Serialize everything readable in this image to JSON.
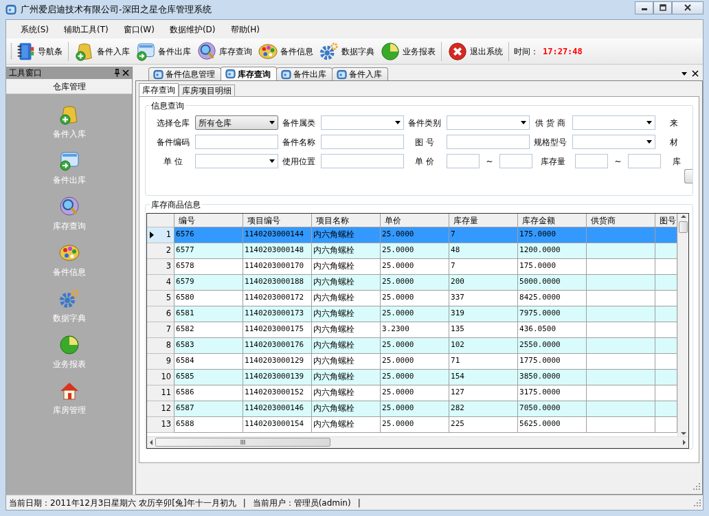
{
  "window": {
    "title": "广州爱启迪技术有限公司-深田之星仓库管理系统"
  },
  "menu": [
    {
      "label": "系统(S)"
    },
    {
      "label": "辅助工具(T)"
    },
    {
      "label": "窗口(W)"
    },
    {
      "label": "数据维护(D)"
    },
    {
      "label": "帮助(H)"
    }
  ],
  "toolbar": {
    "buttons": [
      {
        "label": "导航条"
      },
      {
        "label": "备件入库"
      },
      {
        "label": "备件出库"
      },
      {
        "label": "库存查询"
      },
      {
        "label": "备件信息"
      },
      {
        "label": "数据字典"
      },
      {
        "label": "业务报表"
      }
    ],
    "exit_button": {
      "label": "退出系统"
    },
    "clock_label": "时间：",
    "clock": "17:27:48"
  },
  "tool_window": {
    "title": "工具窗口",
    "section": "仓库管理",
    "items": [
      {
        "label": "备件入库"
      },
      {
        "label": "备件出库"
      },
      {
        "label": "库存查询"
      },
      {
        "label": "备件信息"
      },
      {
        "label": "数据字典"
      },
      {
        "label": "业务报表"
      },
      {
        "label": "库房管理"
      }
    ]
  },
  "document_tabs": [
    {
      "label": "备件信息管理",
      "selected": false
    },
    {
      "label": "库存查询",
      "selected": true
    },
    {
      "label": "备件出库",
      "selected": false
    },
    {
      "label": "备件入库",
      "selected": false
    }
  ],
  "page_tabs": [
    {
      "label": "库存查询",
      "selected": true
    },
    {
      "label": "库房项目明细",
      "selected": false
    }
  ],
  "query": {
    "title": "信息查询",
    "rows": [
      [
        {
          "label": "选择仓库",
          "kind": "dropdown",
          "value": "所有仓库"
        },
        {
          "label": "备件属类",
          "kind": "dropdown"
        },
        {
          "label": "备件类别",
          "kind": "dropdown"
        },
        {
          "label": "供 货 商",
          "kind": "dropdown"
        },
        {
          "label": "来",
          "kind": "label"
        }
      ],
      [
        {
          "label": "备件编码",
          "kind": "text"
        },
        {
          "label": "备件名称",
          "kind": "text"
        },
        {
          "label": "图 号",
          "kind": "text"
        },
        {
          "label": "规格型号",
          "kind": "dropdown"
        },
        {
          "label": "材",
          "kind": "label"
        }
      ],
      [
        {
          "label": "单 位",
          "kind": "dropdown"
        },
        {
          "label": "使用位置",
          "kind": "text"
        },
        {
          "label": "单 价",
          "kind": "range",
          "separator": "~"
        },
        {
          "label": "库存量",
          "kind": "range",
          "separator": "~"
        },
        {
          "label": "库",
          "kind": "label"
        }
      ]
    ]
  },
  "grid": {
    "title": "库存商品信息",
    "columns": [
      "编号",
      "项目编号",
      "项目名称",
      "单价",
      "库存量",
      "库存金额",
      "供货商",
      "图号"
    ],
    "rows": [
      {
        "number": "1",
        "selected": true,
        "cells": [
          "6576",
          "1140203000144",
          "内六角螺栓",
          "25.0000",
          "7",
          "175.0000"
        ]
      },
      {
        "number": "2",
        "selected": false,
        "cells": [
          "6577",
          "1140203000148",
          "内六角螺栓",
          "25.0000",
          "48",
          "1200.0000"
        ]
      },
      {
        "number": "3",
        "selected": false,
        "cells": [
          "6578",
          "1140203000170",
          "内六角螺栓",
          "25.0000",
          "7",
          "175.0000"
        ]
      },
      {
        "number": "4",
        "selected": false,
        "cells": [
          "6579",
          "1140203000188",
          "内六角螺栓",
          "25.0000",
          "200",
          "5000.0000"
        ]
      },
      {
        "number": "5",
        "selected": false,
        "cells": [
          "6580",
          "1140203000172",
          "内六角螺栓",
          "25.0000",
          "337",
          "8425.0000"
        ]
      },
      {
        "number": "6",
        "selected": false,
        "cells": [
          "6581",
          "1140203000173",
          "内六角螺栓",
          "25.0000",
          "319",
          "7975.0000"
        ]
      },
      {
        "number": "7",
        "selected": false,
        "cells": [
          "6582",
          "1140203000175",
          "内六角螺栓",
          "3.2300",
          "135",
          "436.0500"
        ]
      },
      {
        "number": "8",
        "selected": false,
        "cells": [
          "6583",
          "1140203000176",
          "内六角螺栓",
          "25.0000",
          "102",
          "2550.0000"
        ]
      },
      {
        "number": "9",
        "selected": false,
        "cells": [
          "6584",
          "1140203000129",
          "内六角螺栓",
          "25.0000",
          "71",
          "1775.0000"
        ]
      },
      {
        "number": "10",
        "selected": false,
        "cells": [
          "6585",
          "1140203000139",
          "内六角螺栓",
          "25.0000",
          "154",
          "3850.0000"
        ]
      },
      {
        "number": "11",
        "selected": false,
        "cells": [
          "6586",
          "1140203000152",
          "内六角螺栓",
          "25.0000",
          "127",
          "3175.0000"
        ]
      },
      {
        "number": "12",
        "selected": false,
        "cells": [
          "6587",
          "1140203000146",
          "内六角螺栓",
          "25.0000",
          "282",
          "7050.0000"
        ]
      },
      {
        "number": "13",
        "selected": false,
        "cells": [
          "6588",
          "1140203000154",
          "内六角螺栓",
          "25.0000",
          "225",
          "5625.0000"
        ]
      }
    ]
  },
  "status_bar": {
    "items": [
      "当前日期：2011年12月3日星期六 农历辛卯[兔]年十一月初九",
      "|",
      "当前用户：管理员(admin)",
      "|"
    ]
  }
}
